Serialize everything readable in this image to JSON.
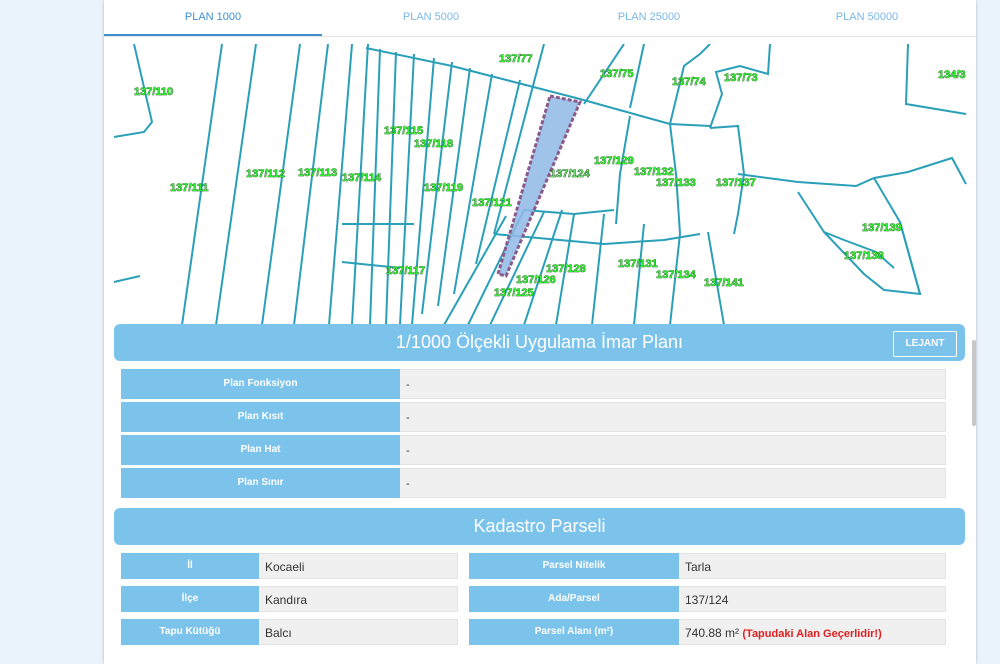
{
  "tabs": [
    {
      "label": "PLAN 1000",
      "active": true
    },
    {
      "label": "PLAN 5000",
      "active": false
    },
    {
      "label": "PLAN 25000",
      "active": false
    },
    {
      "label": "PLAN 50000",
      "active": false
    }
  ],
  "map": {
    "parcel_labels": [
      "137/77",
      "137/75",
      "137/74",
      "137/73",
      "134/3",
      "137/110",
      "137/115",
      "137/118",
      "137/129",
      "137/112",
      "137/113",
      "137/114",
      "137/111",
      "137/119",
      "137/121",
      "137/132",
      "137/133",
      "137/137",
      "137/139",
      "137/138",
      "137/117",
      "137/126",
      "137/128",
      "137/125",
      "137/131",
      "137/134",
      "137/141",
      "137/124"
    ],
    "selected_parcel": "137/124",
    "colors": {
      "parcel_line": "#2aa0b8",
      "selected_fill": "#8fb8e6",
      "selected_border": "#8a5a8a",
      "label_fill": "#33ee33"
    }
  },
  "plan_section": {
    "title": "1/1000 Ölçekli Uygulama İmar Planı",
    "legend_button": "LEJANT",
    "rows": [
      {
        "key": "Plan Fonksiyon",
        "value": "-"
      },
      {
        "key": "Plan Kısıt",
        "value": "-"
      },
      {
        "key": "Plan Hat",
        "value": "-"
      },
      {
        "key": "Plan Sınır",
        "value": "-"
      }
    ]
  },
  "cadastre_section": {
    "title": "Kadastro Parseli",
    "left": [
      {
        "key": "İl",
        "value": "Kocaeli"
      },
      {
        "key": "İlçe",
        "value": "Kandıra"
      },
      {
        "key": "Tapu Kütüğü",
        "value": "Balcı"
      }
    ],
    "right": [
      {
        "key": "Parsel Nitelik",
        "value": "Tarla"
      },
      {
        "key": "Ada/Parsel",
        "value": "137/124"
      },
      {
        "key": "Parsel Alanı (m²)",
        "value": "740.88 m²",
        "note": "(Tapudaki Alan Geçerlidir!)"
      }
    ]
  },
  "colors": {
    "accent": "#7cc3ec",
    "tab_active": "#3e8fcf",
    "warning": "#e02020"
  }
}
